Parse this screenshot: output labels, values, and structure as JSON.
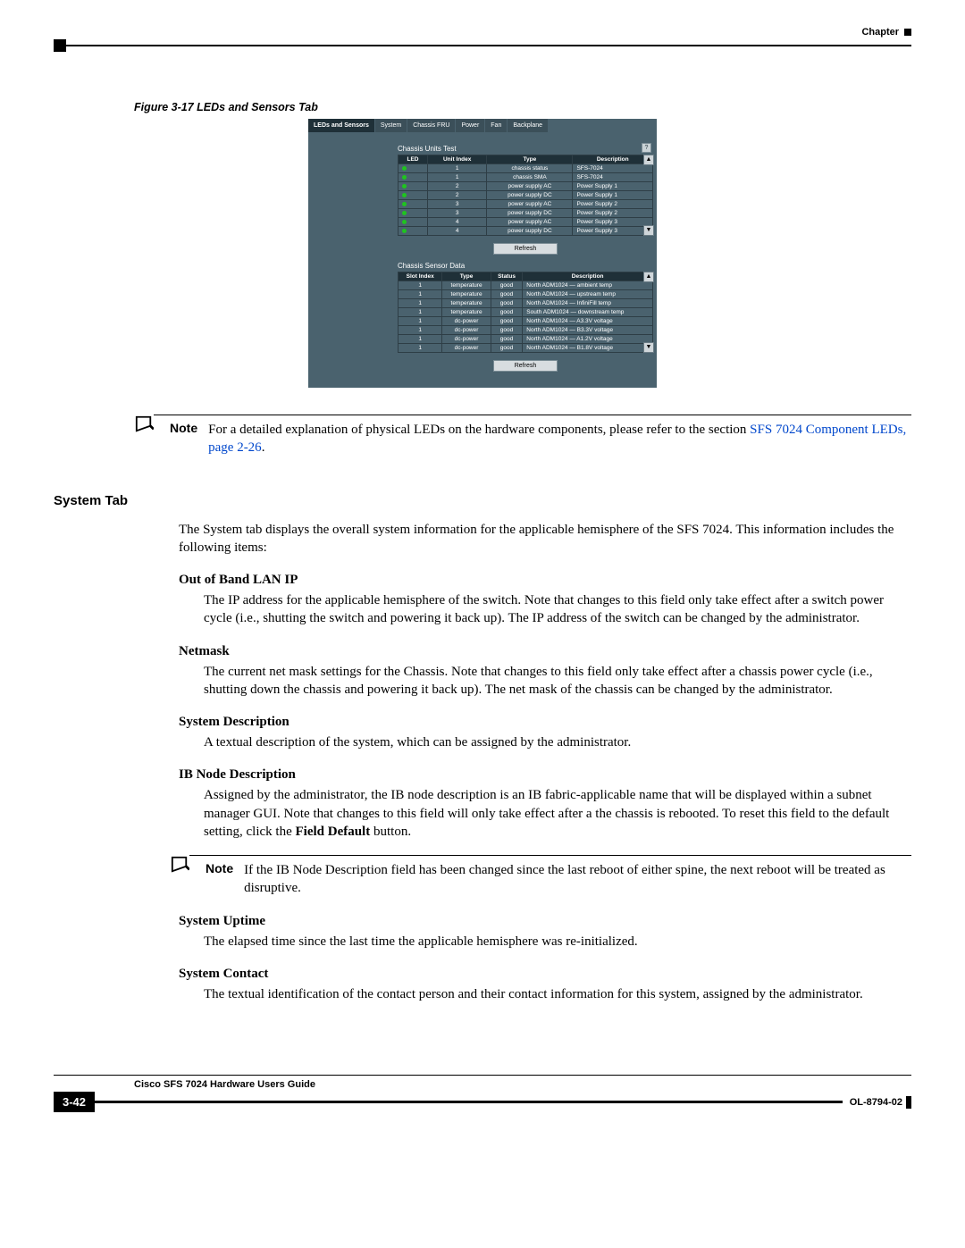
{
  "header": {
    "chapter_label": "Chapter"
  },
  "figure": {
    "caption": "Figure 3-17    LEDs and Sensors Tab"
  },
  "screenshot": {
    "tabs": [
      "LEDs and Sensors",
      "System",
      "Chassis FRU",
      "Power",
      "Fan",
      "Backplane"
    ],
    "active_tab_index": 0,
    "units_title": "Chassis Units Test",
    "units_cols": [
      "LED",
      "Unit Index",
      "Type",
      "Description"
    ],
    "units_rows": [
      {
        "idx": "1",
        "type": "chassis status",
        "desc": "SFS-7024"
      },
      {
        "idx": "1",
        "type": "chassis SMA",
        "desc": "SFS-7024"
      },
      {
        "idx": "2",
        "type": "power supply AC",
        "desc": "Power Supply 1"
      },
      {
        "idx": "2",
        "type": "power supply DC",
        "desc": "Power Supply 1"
      },
      {
        "idx": "3",
        "type": "power supply AC",
        "desc": "Power Supply 2"
      },
      {
        "idx": "3",
        "type": "power supply DC",
        "desc": "Power Supply 2"
      },
      {
        "idx": "4",
        "type": "power supply AC",
        "desc": "Power Supply 3"
      },
      {
        "idx": "4",
        "type": "power supply DC",
        "desc": "Power Supply 3"
      }
    ],
    "sensor_title": "Chassis Sensor Data",
    "sensor_cols": [
      "Slot Index",
      "Type",
      "Status",
      "Description"
    ],
    "sensor_rows": [
      {
        "slot": "1",
        "type": "temperature",
        "status": "good",
        "desc": "North ADM1024 — ambient temp"
      },
      {
        "slot": "1",
        "type": "temperature",
        "status": "good",
        "desc": "North ADM1024 — upstream temp"
      },
      {
        "slot": "1",
        "type": "temperature",
        "status": "good",
        "desc": "North ADM1024 — InfiniFill temp"
      },
      {
        "slot": "1",
        "type": "temperature",
        "status": "good",
        "desc": "South ADM1024 — downstream temp"
      },
      {
        "slot": "1",
        "type": "dc-power",
        "status": "good",
        "desc": "North ADM1024 — A3.3V voltage"
      },
      {
        "slot": "1",
        "type": "dc-power",
        "status": "good",
        "desc": "North ADM1024 — B3.3V voltage"
      },
      {
        "slot": "1",
        "type": "dc-power",
        "status": "good",
        "desc": "North ADM1024 — A1.2V voltage"
      },
      {
        "slot": "1",
        "type": "dc-power",
        "status": "good",
        "desc": "North ADM1024 — B1.8V voltage"
      }
    ],
    "refresh_label": "Refresh"
  },
  "note1": {
    "label": "Note",
    "text_a": "For a detailed explanation of physical LEDs on the hardware components, please refer to the section ",
    "link": "SFS 7024 Component LEDs, page 2-26",
    "text_b": "."
  },
  "section": {
    "heading": "System Tab",
    "intro": "The System tab displays the overall system information for the applicable hemisphere of the SFS 7024. This information includes the following items:"
  },
  "items": {
    "oob": {
      "term": "Out of Band LAN IP",
      "def": "The IP address for the applicable hemisphere of the switch. Note that changes to this field only take effect after a switch power cycle (i.e., shutting the switch and powering it back up). The IP address of the switch can be changed by the administrator."
    },
    "netmask": {
      "term": "Netmask",
      "def": "The current net mask settings for the Chassis. Note that changes to this field only take effect after a chassis power cycle (i.e., shutting down the chassis and powering it back up). The net mask of the chassis can be changed by the administrator."
    },
    "sysdesc": {
      "term": "System Description",
      "def": "A textual description of the system, which can be assigned by the administrator."
    },
    "ibnode": {
      "term": "IB Node Description",
      "def_a": "Assigned by the administrator, the IB node description is an IB fabric-applicable name that will be displayed within a subnet manager GUI. Note that changes to this field will only take effect after a the chassis is rebooted. To reset this field to the default setting, click the ",
      "def_bold": "Field Default",
      "def_b": " button."
    },
    "uptime": {
      "term": "System Uptime",
      "def": "The elapsed time since the last time the applicable hemisphere was re-initialized."
    },
    "contact": {
      "term": "System Contact",
      "def": "The textual identification of the contact person and their contact information for this system, assigned by the administrator."
    }
  },
  "note2": {
    "label": "Note",
    "text": "If the IB Node Description field has been changed since the last reboot of either spine, the next reboot will be treated as disruptive."
  },
  "footer": {
    "doc_title": "Cisco SFS 7024 Hardware Users Guide",
    "page": "3-42",
    "doc_id": "OL-8794-02"
  }
}
